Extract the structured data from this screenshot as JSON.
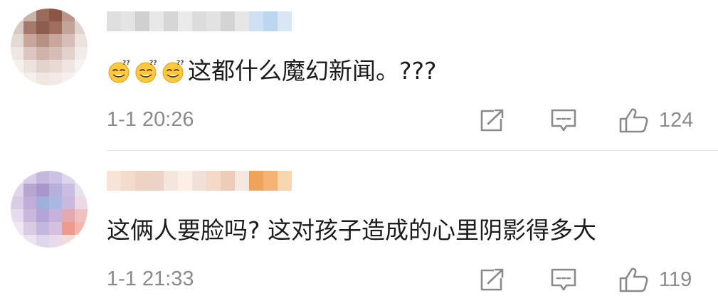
{
  "comments": [
    {
      "text": "这都什么魔幻新闻。???",
      "emoji_count": 3,
      "emoji_icon": "thinking-squint-emoji",
      "timestamp": "1-1 20:26",
      "likes": "124",
      "avatar_colors": [
        "#e8e2df",
        "#c9b4ac",
        "#9a6a5c",
        "#8c5546",
        "#b8948a",
        "#ece7e4",
        "#d8c8c3",
        "#a5786c",
        "#8e5c4e",
        "#a06e61",
        "#c3a49b",
        "#e0d5d1",
        "#e5d9d5",
        "#c7a69c",
        "#b89185",
        "#c8a89e",
        "#d6bdb5",
        "#ece2de",
        "#efe7e4",
        "#dcc6bf",
        "#cfb3aa",
        "#d6bdb5",
        "#e2d0ca",
        "#f2ece9",
        "#f5f1ef",
        "#ede2de",
        "#e4d2cc",
        "#e8d9d4",
        "#efe6e2",
        "#f7f3f1",
        "#fbf9f8",
        "#f5efec",
        "#f0e6e2",
        "#f2eae6",
        "#f6f0ee",
        "#fbf9f8"
      ],
      "username_colors": [
        "#dedede",
        "#e4e4e4",
        "#d0d0d0",
        "#e8e8e8",
        "#d6d6d6",
        "#eaeaea",
        "#dcdcdc",
        "#e2e2e2",
        "#d4d4d4",
        "#e6e6e6",
        "#cfe0f2",
        "#bcd6ef",
        "#d9e7f4"
      ]
    },
    {
      "text": "这俩人要脸吗? 这对孩子造成的心里阴影得多大",
      "timestamp": "1-1 21:33",
      "likes": "119",
      "avatar_colors": [
        "#ece8f2",
        "#d6cde6",
        "#c6b8dd",
        "#cbc3e4",
        "#ddd6ec",
        "#f0edf5",
        "#e0d6ea",
        "#b8a6d2",
        "#a996cb",
        "#b6b0dc",
        "#c8bfe0",
        "#e6e2f0",
        "#d9cde6",
        "#c1aed8",
        "#9fb0dc",
        "#aab8e0",
        "#c9b9df",
        "#ecd9e6",
        "#e6dbec",
        "#cab7dc",
        "#b4a5d6",
        "#c6b3dc",
        "#e3a8b0",
        "#f0c2bf",
        "#efe8f3",
        "#d9cbe4",
        "#c3b6df",
        "#d5c0df",
        "#ee9a8e",
        "#f4b7ac",
        "#f8f5fa",
        "#ece4f1",
        "#e0d6ec",
        "#e8dcec",
        "#f4dcd8",
        "#faf5f6"
      ],
      "username_colors": [
        "#f7e3d6",
        "#f4dccc",
        "#efd3c2",
        "#ecd3c6",
        "#f3e6dc",
        "#fbefe6",
        "#f1e0d6",
        "#f5d9c7",
        "#eecdb8",
        "#f5e8df",
        "#f0a45a",
        "#f4b574",
        "#f8d7b0"
      ]
    }
  ],
  "icons": {
    "share": "share-icon",
    "reply": "comment-icon",
    "like": "thumbs-up-icon"
  },
  "colors": {
    "meta_text": "#8a8a8a",
    "divider": "#e6e6e6",
    "emoji_yellow": "#ffc83d"
  }
}
